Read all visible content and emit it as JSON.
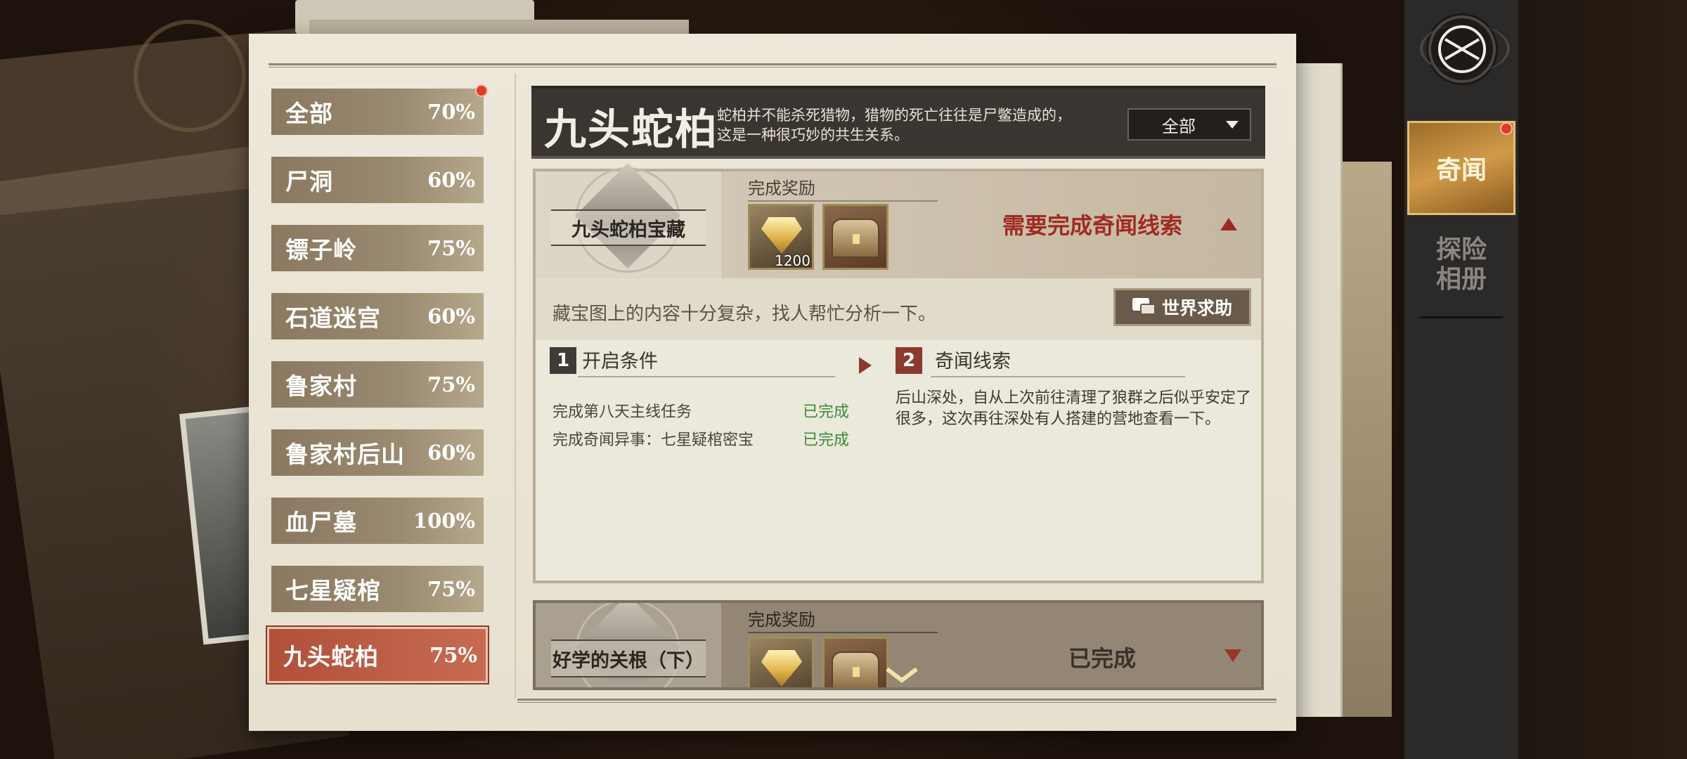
{
  "sidebar": {
    "items": [
      {
        "name": "全部",
        "pct": "70%",
        "badge": true
      },
      {
        "name": "尸洞",
        "pct": "60%"
      },
      {
        "name": "镖子岭",
        "pct": "75%"
      },
      {
        "name": "石道迷宫",
        "pct": "60%"
      },
      {
        "name": "鲁家村",
        "pct": "75%"
      },
      {
        "name": "鲁家村后山",
        "pct": "60%"
      },
      {
        "name": "血尸墓",
        "pct": "100%"
      },
      {
        "name": "七星疑棺",
        "pct": "75%"
      },
      {
        "name": "九头蛇柏",
        "pct": "75%",
        "active": true
      }
    ]
  },
  "header": {
    "title": "九头蛇柏",
    "description": "蛇柏并不能杀死猎物，猎物的死亡往往是尸鳖造成的，这是一种很巧妙的共生关系。",
    "filter": "全部"
  },
  "card1": {
    "task_title": "九头蛇柏宝藏",
    "reward_label": "完成奖励",
    "rewards": [
      {
        "icon": "diamond-icon",
        "count": "1200"
      },
      {
        "icon": "treasure-chest-icon"
      }
    ],
    "status": "需要完成奇闻线索",
    "hint": "藏宝图上的内容十分复杂，找人帮忙分析一下。",
    "help_button": "世界求助",
    "section1": {
      "num": "1",
      "title": "开启条件",
      "conditions": [
        {
          "text": "完成第八天主线任务",
          "status": "已完成"
        },
        {
          "text": "完成奇闻异事：七星疑棺密宝",
          "status": "已完成"
        }
      ]
    },
    "section2": {
      "num": "2",
      "title": "奇闻线索",
      "text": "后山深处，自从上次前往清理了狼群之后似乎安定了很多，这次再往深处有人搭建的营地查看一下。"
    }
  },
  "card2": {
    "task_title": "好学的关根（下）",
    "reward_label": "完成奖励",
    "status": "已完成"
  },
  "rail": {
    "tab_active": "奇闻",
    "tab_inactive": "探险相册",
    "badge": true
  },
  "colors": {
    "accent_red": "#a02a22",
    "done_green": "#3d8a3a",
    "active_tab": "#b0503a",
    "gold_tab": "#c08a3a"
  }
}
